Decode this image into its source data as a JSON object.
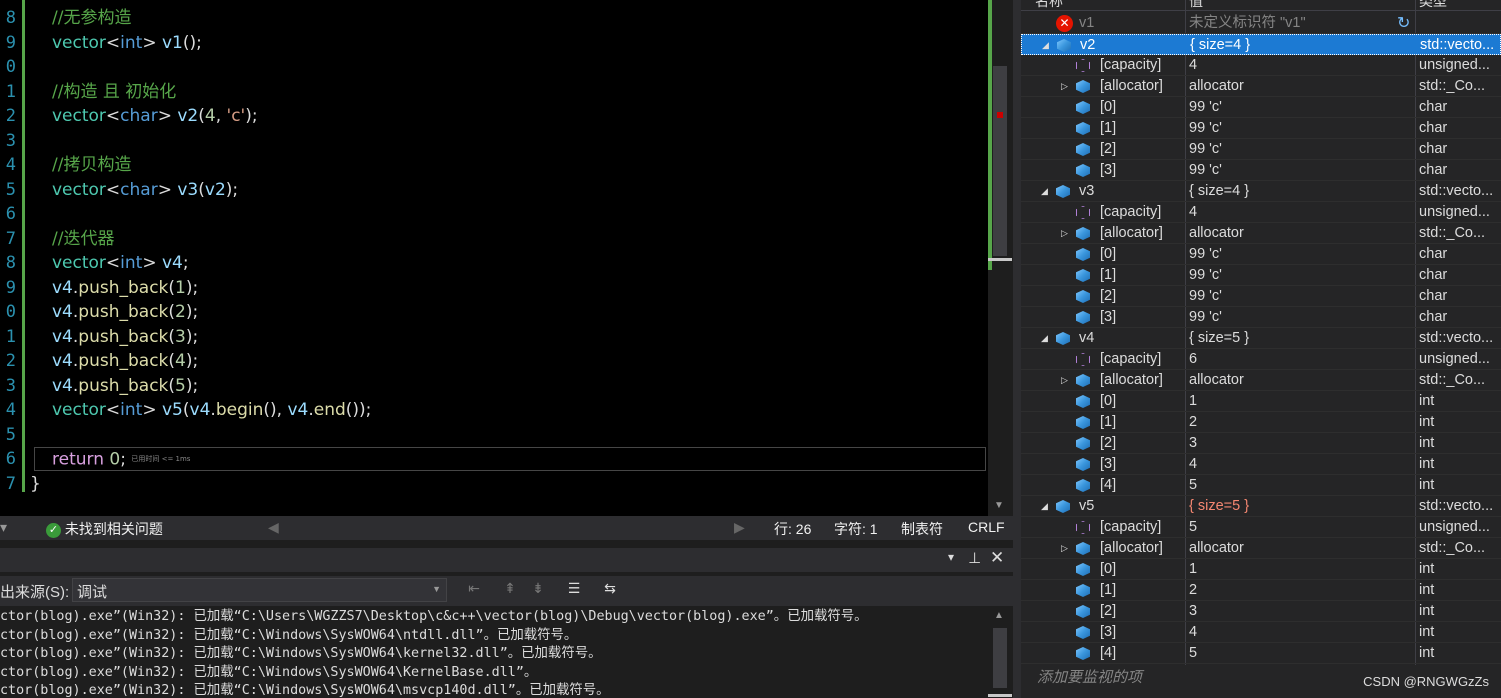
{
  "editor": {
    "line_numbers": [
      "8",
      "9",
      "0",
      "1",
      "2",
      "3",
      "4",
      "5",
      "6",
      "7",
      "8",
      "9",
      "0",
      "1",
      "2",
      "3",
      "4",
      "5",
      "6",
      "7"
    ],
    "lines": [
      [
        {
          "c": "cmt",
          "t": "//无参构造"
        }
      ],
      [
        {
          "c": "ty",
          "t": "vector"
        },
        {
          "c": "",
          "t": "<"
        },
        {
          "c": "kw",
          "t": "int"
        },
        {
          "c": "",
          "t": "> "
        },
        {
          "c": "vr",
          "t": "v1"
        },
        {
          "c": "",
          "t": "();"
        }
      ],
      [],
      [
        {
          "c": "cmt",
          "t": "//构造 且 初始化"
        }
      ],
      [
        {
          "c": "ty",
          "t": "vector"
        },
        {
          "c": "",
          "t": "<"
        },
        {
          "c": "kw",
          "t": "char"
        },
        {
          "c": "",
          "t": "> "
        },
        {
          "c": "vr",
          "t": "v2"
        },
        {
          "c": "",
          "t": "("
        },
        {
          "c": "num",
          "t": "4"
        },
        {
          "c": "",
          "t": ", "
        },
        {
          "c": "str",
          "t": "'c'"
        },
        {
          "c": "",
          "t": ");"
        }
      ],
      [],
      [
        {
          "c": "cmt",
          "t": "//拷贝构造"
        }
      ],
      [
        {
          "c": "ty",
          "t": "vector"
        },
        {
          "c": "",
          "t": "<"
        },
        {
          "c": "kw",
          "t": "char"
        },
        {
          "c": "",
          "t": "> "
        },
        {
          "c": "vr",
          "t": "v3"
        },
        {
          "c": "",
          "t": "("
        },
        {
          "c": "vr",
          "t": "v2"
        },
        {
          "c": "",
          "t": ");"
        }
      ],
      [],
      [
        {
          "c": "cmt",
          "t": "//迭代器"
        }
      ],
      [
        {
          "c": "ty",
          "t": "vector"
        },
        {
          "c": "",
          "t": "<"
        },
        {
          "c": "kw",
          "t": "int"
        },
        {
          "c": "",
          "t": "> "
        },
        {
          "c": "vr",
          "t": "v4"
        },
        {
          "c": "",
          "t": ";"
        }
      ],
      [
        {
          "c": "vr",
          "t": "v4"
        },
        {
          "c": "",
          "t": "."
        },
        {
          "c": "fn",
          "t": "push_back"
        },
        {
          "c": "",
          "t": "("
        },
        {
          "c": "num",
          "t": "1"
        },
        {
          "c": "",
          "t": ");"
        }
      ],
      [
        {
          "c": "vr",
          "t": "v4"
        },
        {
          "c": "",
          "t": "."
        },
        {
          "c": "fn",
          "t": "push_back"
        },
        {
          "c": "",
          "t": "("
        },
        {
          "c": "num",
          "t": "2"
        },
        {
          "c": "",
          "t": ");"
        }
      ],
      [
        {
          "c": "vr",
          "t": "v4"
        },
        {
          "c": "",
          "t": "."
        },
        {
          "c": "fn",
          "t": "push_back"
        },
        {
          "c": "",
          "t": "("
        },
        {
          "c": "num",
          "t": "3"
        },
        {
          "c": "",
          "t": ");"
        }
      ],
      [
        {
          "c": "vr",
          "t": "v4"
        },
        {
          "c": "",
          "t": "."
        },
        {
          "c": "fn",
          "t": "push_back"
        },
        {
          "c": "",
          "t": "("
        },
        {
          "c": "num",
          "t": "4"
        },
        {
          "c": "",
          "t": ");"
        }
      ],
      [
        {
          "c": "vr",
          "t": "v4"
        },
        {
          "c": "",
          "t": "."
        },
        {
          "c": "fn",
          "t": "push_back"
        },
        {
          "c": "",
          "t": "("
        },
        {
          "c": "num",
          "t": "5"
        },
        {
          "c": "",
          "t": ");"
        }
      ],
      [
        {
          "c": "ty",
          "t": "vector"
        },
        {
          "c": "",
          "t": "<"
        },
        {
          "c": "kw",
          "t": "int"
        },
        {
          "c": "",
          "t": "> "
        },
        {
          "c": "vr",
          "t": "v5"
        },
        {
          "c": "",
          "t": "("
        },
        {
          "c": "vr",
          "t": "v4"
        },
        {
          "c": "",
          "t": "."
        },
        {
          "c": "fn",
          "t": "begin"
        },
        {
          "c": "",
          "t": "(), "
        },
        {
          "c": "vr",
          "t": "v4"
        },
        {
          "c": "",
          "t": "."
        },
        {
          "c": "fn",
          "t": "end"
        },
        {
          "c": "",
          "t": "());"
        }
      ],
      [],
      [
        {
          "c": "ret",
          "t": "return"
        },
        {
          "c": "",
          "t": " "
        },
        {
          "c": "num",
          "t": "0"
        },
        {
          "c": "",
          "t": ";"
        }
      ],
      [
        {
          "c": "",
          "t": "}"
        }
      ]
    ],
    "elapsed_hint": "已用时间 <= 1ms"
  },
  "status": {
    "issues": "未找到相关问题",
    "line": "行: 26",
    "char": "字符: 1",
    "tabs": "制表符",
    "eol": "CRLF"
  },
  "output": {
    "source_label": "出来源(S):",
    "source_value": "调试",
    "lines": [
      "ctor(blog).exe”(Win32): 已加载“C:\\Users\\WGZZS7\\Desktop\\c&c++\\vector(blog)\\Debug\\vector(blog).exe”。已加载符号。",
      "ctor(blog).exe”(Win32): 已加载“C:\\Windows\\SysWOW64\\ntdll.dll”。已加载符号。",
      "ctor(blog).exe”(Win32): 已加载“C:\\Windows\\SysWOW64\\kernel32.dll”。已加载符号。",
      "ctor(blog).exe”(Win32): 已加载“C:\\Windows\\SysWOW64\\KernelBase.dll”。",
      "ctor(blog).exe”(Win32): 已加载“C:\\Windows\\SysWOW64\\msvcp140d.dll”。已加载符号。"
    ]
  },
  "watch": {
    "headers": {
      "name": "名称",
      "value": "值",
      "type": "类型"
    },
    "rows": [
      {
        "lvl": 0,
        "exp": "",
        "icon": "error",
        "name": "v1",
        "value": "未定义标识符 \"v1\"",
        "type": "",
        "dim": true,
        "refresh": true
      },
      {
        "lvl": 0,
        "exp": "open",
        "icon": "blue",
        "name": "v2",
        "value": "{ size=4 }",
        "type": "std::vecto...",
        "selected": true
      },
      {
        "lvl": 1,
        "exp": "",
        "icon": "purple",
        "name": "[capacity]",
        "value": "4",
        "type": "unsigned..."
      },
      {
        "lvl": 1,
        "exp": "closed",
        "icon": "blue",
        "name": "[allocator]",
        "value": "allocator",
        "type": "std::_Co..."
      },
      {
        "lvl": 1,
        "exp": "",
        "icon": "blue",
        "name": "[0]",
        "value": "99 'c'",
        "type": "char"
      },
      {
        "lvl": 1,
        "exp": "",
        "icon": "blue",
        "name": "[1]",
        "value": "99 'c'",
        "type": "char"
      },
      {
        "lvl": 1,
        "exp": "",
        "icon": "blue",
        "name": "[2]",
        "value": "99 'c'",
        "type": "char"
      },
      {
        "lvl": 1,
        "exp": "",
        "icon": "blue",
        "name": "[3]",
        "value": "99 'c'",
        "type": "char"
      },
      {
        "lvl": 0,
        "exp": "open",
        "icon": "blue",
        "name": "v3",
        "value": "{ size=4 }",
        "type": "std::vecto..."
      },
      {
        "lvl": 1,
        "exp": "",
        "icon": "purple",
        "name": "[capacity]",
        "value": "4",
        "type": "unsigned..."
      },
      {
        "lvl": 1,
        "exp": "closed",
        "icon": "blue",
        "name": "[allocator]",
        "value": "allocator",
        "type": "std::_Co..."
      },
      {
        "lvl": 1,
        "exp": "",
        "icon": "blue",
        "name": "[0]",
        "value": "99 'c'",
        "type": "char"
      },
      {
        "lvl": 1,
        "exp": "",
        "icon": "blue",
        "name": "[1]",
        "value": "99 'c'",
        "type": "char"
      },
      {
        "lvl": 1,
        "exp": "",
        "icon": "blue",
        "name": "[2]",
        "value": "99 'c'",
        "type": "char"
      },
      {
        "lvl": 1,
        "exp": "",
        "icon": "blue",
        "name": "[3]",
        "value": "99 'c'",
        "type": "char"
      },
      {
        "lvl": 0,
        "exp": "open",
        "icon": "blue",
        "name": "v4",
        "value": "{ size=5 }",
        "type": "std::vecto..."
      },
      {
        "lvl": 1,
        "exp": "",
        "icon": "purple",
        "name": "[capacity]",
        "value": "6",
        "type": "unsigned..."
      },
      {
        "lvl": 1,
        "exp": "closed",
        "icon": "blue",
        "name": "[allocator]",
        "value": "allocator",
        "type": "std::_Co..."
      },
      {
        "lvl": 1,
        "exp": "",
        "icon": "blue",
        "name": "[0]",
        "value": "1",
        "type": "int"
      },
      {
        "lvl": 1,
        "exp": "",
        "icon": "blue",
        "name": "[1]",
        "value": "2",
        "type": "int"
      },
      {
        "lvl": 1,
        "exp": "",
        "icon": "blue",
        "name": "[2]",
        "value": "3",
        "type": "int"
      },
      {
        "lvl": 1,
        "exp": "",
        "icon": "blue",
        "name": "[3]",
        "value": "4",
        "type": "int"
      },
      {
        "lvl": 1,
        "exp": "",
        "icon": "blue",
        "name": "[4]",
        "value": "5",
        "type": "int"
      },
      {
        "lvl": 0,
        "exp": "open",
        "icon": "blue",
        "name": "v5",
        "value": "{ size=5 }",
        "type": "std::vecto...",
        "changed": true
      },
      {
        "lvl": 1,
        "exp": "",
        "icon": "purple",
        "name": "[capacity]",
        "value": "5",
        "type": "unsigned..."
      },
      {
        "lvl": 1,
        "exp": "closed",
        "icon": "blue",
        "name": "[allocator]",
        "value": "allocator",
        "type": "std::_Co..."
      },
      {
        "lvl": 1,
        "exp": "",
        "icon": "blue",
        "name": "[0]",
        "value": "1",
        "type": "int"
      },
      {
        "lvl": 1,
        "exp": "",
        "icon": "blue",
        "name": "[1]",
        "value": "2",
        "type": "int"
      },
      {
        "lvl": 1,
        "exp": "",
        "icon": "blue",
        "name": "[2]",
        "value": "3",
        "type": "int"
      },
      {
        "lvl": 1,
        "exp": "",
        "icon": "blue",
        "name": "[3]",
        "value": "4",
        "type": "int"
      },
      {
        "lvl": 1,
        "exp": "",
        "icon": "blue",
        "name": "[4]",
        "value": "5",
        "type": "int"
      }
    ],
    "add_placeholder": "添加要监视的项",
    "watermark": "CSDN @RNGWGzZs"
  },
  "colors": {
    "comment": "#57a64a",
    "keyword": "#569cd6",
    "type": "#4ec9b0",
    "selection": "#1c7ad3",
    "changed": "#f48771"
  }
}
